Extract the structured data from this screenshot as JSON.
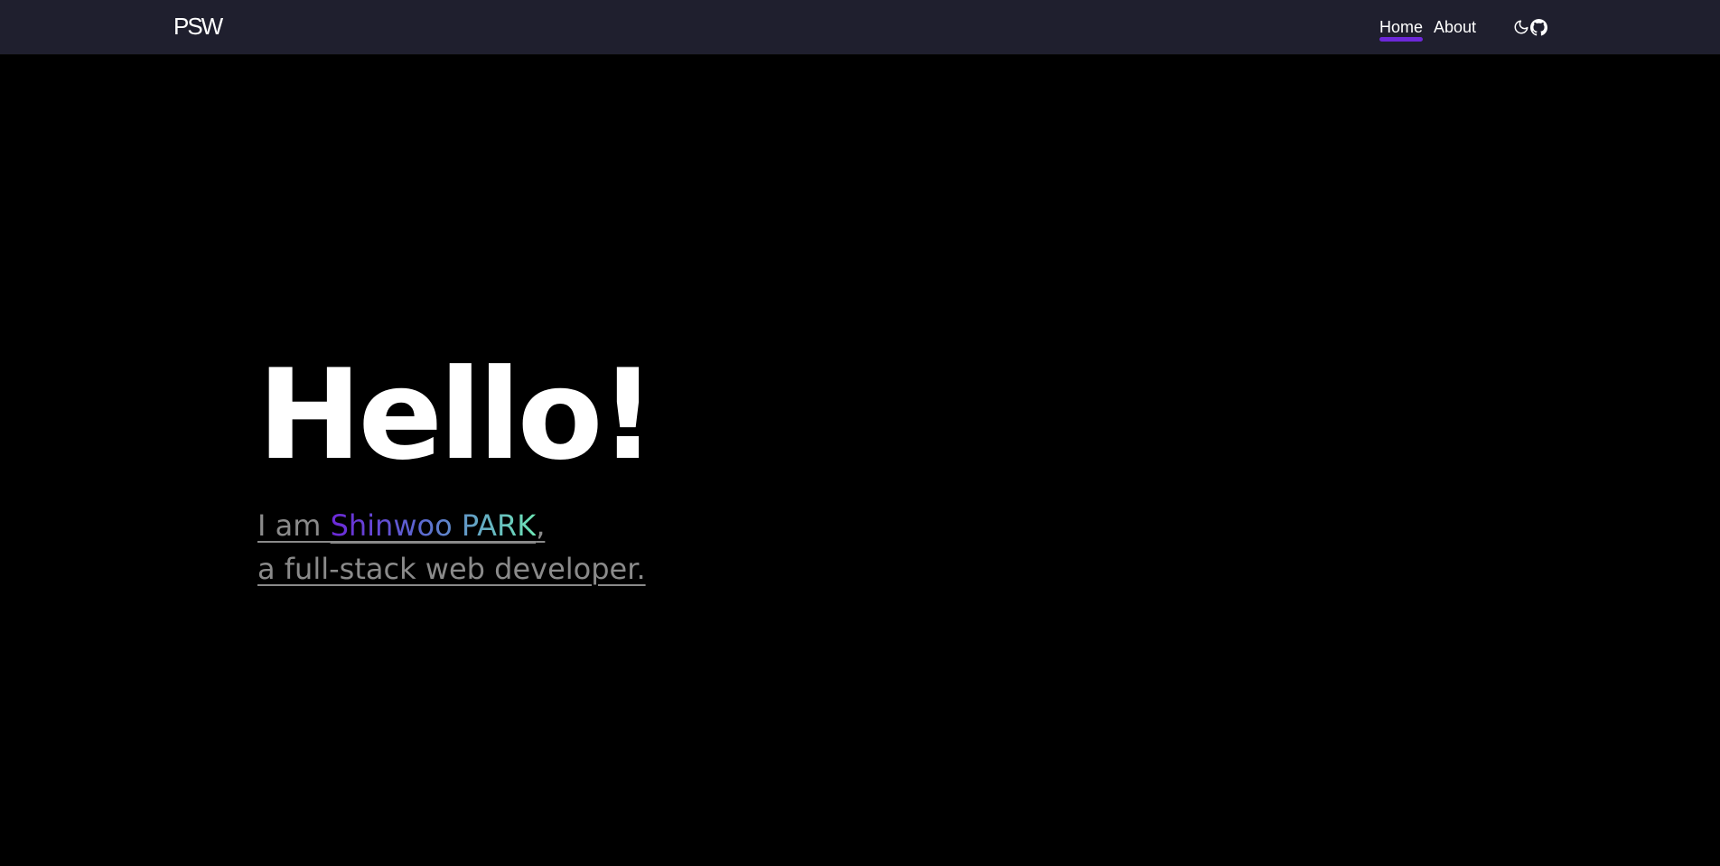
{
  "header": {
    "logo": "PSW",
    "nav": [
      {
        "label": "Home",
        "active": true
      },
      {
        "label": "About",
        "active": false
      }
    ],
    "icons": [
      "moon-icon",
      "github-icon"
    ]
  },
  "hero": {
    "title": "Hello!",
    "intro_prefix": "I am ",
    "name": "Shinwoo PARK",
    "intro_suffix": ",",
    "tagline": "a full-stack web developer."
  },
  "colors": {
    "navbar_bg": "#1f1f2e",
    "page_bg": "#000000",
    "accent": "#6d28d9",
    "gradient_start": "#6d28d9",
    "gradient_end": "#6ee7b7",
    "muted_text": "#8a8a8a"
  }
}
